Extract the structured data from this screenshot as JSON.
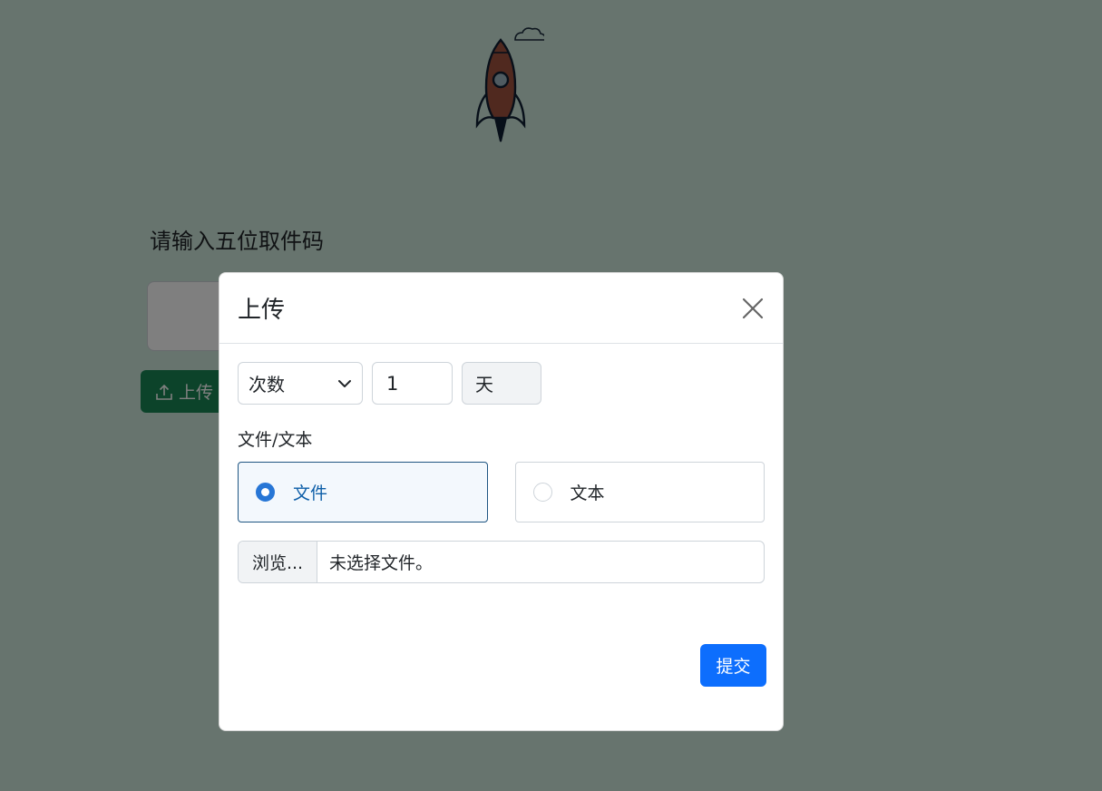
{
  "background": {
    "prompt": "请输入五位取件码",
    "upload_button_label": "上传",
    "icons": {
      "logo": "rocket-logo",
      "upload": "upload-icon"
    }
  },
  "modal": {
    "title": "上传",
    "close_icon": "close-icon",
    "expiry": {
      "type_selected": "次数",
      "value": "1",
      "unit": "天"
    },
    "content_type_label": "文件/文本",
    "options": [
      {
        "label": "文件",
        "selected": true
      },
      {
        "label": "文本",
        "selected": false
      }
    ],
    "file_picker": {
      "browse_label": "浏览...",
      "status": "未选择文件。"
    },
    "submit_label": "提交"
  },
  "colors": {
    "backdrop": "#6a7a72",
    "primary": "#0d6efd",
    "success": "#198754",
    "selected_border": "#1f5582"
  }
}
